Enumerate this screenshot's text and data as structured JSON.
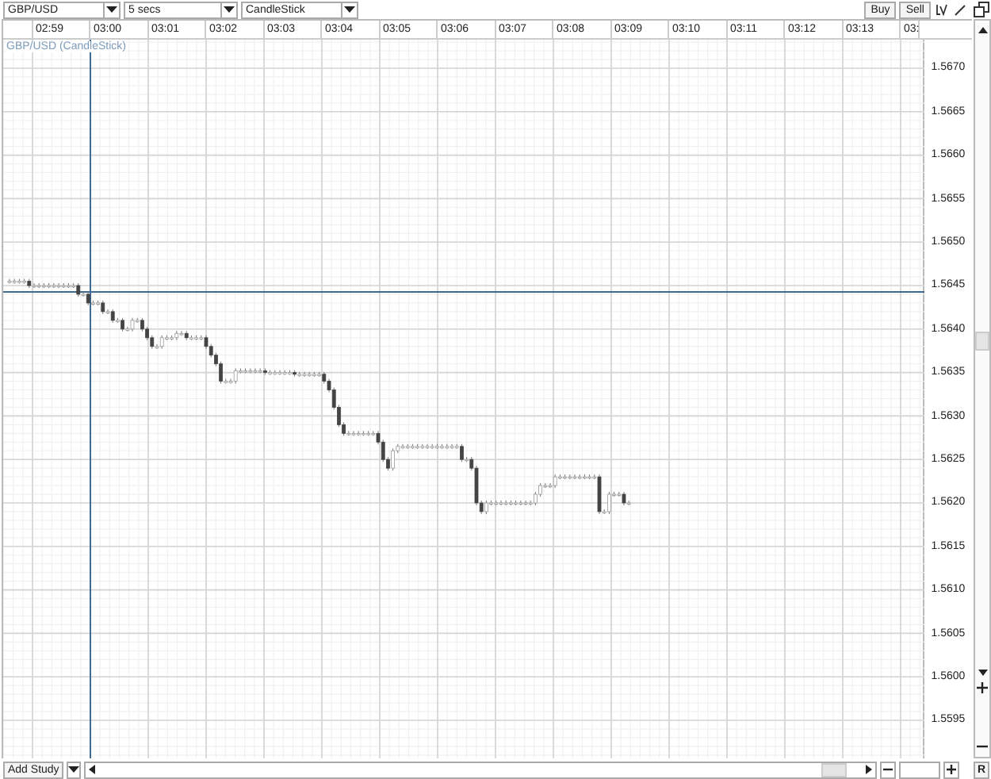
{
  "toolbar": {
    "dropdowns": [
      {
        "kind": "symbol",
        "value": "GBP/USD"
      },
      {
        "kind": "interval",
        "value": "5 secs"
      },
      {
        "kind": "chart-type",
        "value": "CandleStick"
      }
    ],
    "buttons": [
      "Buy",
      "Sell"
    ]
  },
  "chart": {
    "legend": "GBP/USD (CandleStick)",
    "time_labels": [
      "02:59",
      "03:00",
      "03:01",
      "03:02",
      "03:03",
      "03:04",
      "03:05",
      "03:06",
      "03:07",
      "03:08",
      "03:09",
      "03:10",
      "03:11",
      "03:12",
      "03:13",
      "03:"
    ],
    "price_labels": [
      "1.5670",
      "1.5665",
      "1.5660",
      "1.5655",
      "1.5650",
      "1.5645",
      "1.5640",
      "1.5635",
      "1.5630",
      "1.5625",
      "1.5620",
      "1.5615",
      "1.5610",
      "1.5605",
      "1.5600",
      "1.5595"
    ]
  },
  "bottom_bar": {
    "add_study": "Add Study",
    "reset": "R"
  }
}
